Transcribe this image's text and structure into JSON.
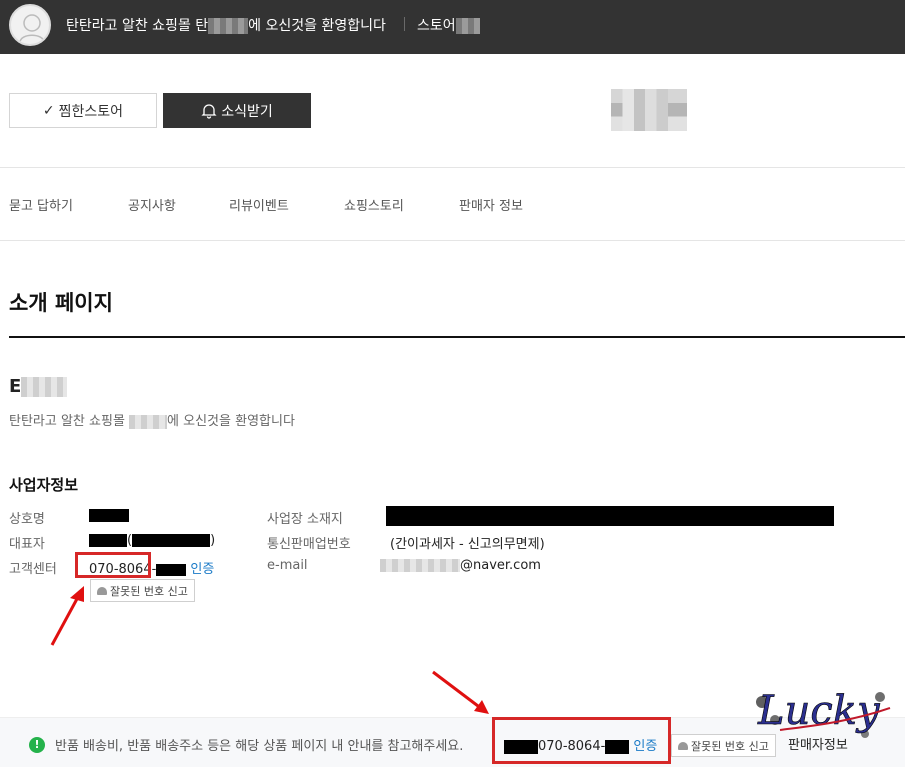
{
  "header": {
    "welcome_prefix": "탄탄라고 알찬 쇼핑몰 탄",
    "welcome_suffix": "에 오신것을 환영합니다",
    "store_link": "스토어"
  },
  "actions": {
    "favorite_label": "찜한스토어",
    "notify_label": "소식받기"
  },
  "nav": {
    "items": [
      "묻고 답하기",
      "공지사항",
      "리뷰이벤트",
      "쇼핑스토리",
      "판매자 정보"
    ]
  },
  "page": {
    "title": "소개 페이지",
    "store_name_initial": "E",
    "store_desc_prefix": "탄탄라고 알찬 쇼핑몰",
    "store_desc_suffix": "에 오신것을 환영합니다"
  },
  "business": {
    "section_title": "사업자정보",
    "labels": {
      "company": "상호명",
      "ceo": "대표자",
      "customer_center": "고객센터",
      "address": "사업장 소재지",
      "mail_order_no": "통신판매업번호",
      "email": "e-mail"
    },
    "ceo_suffix": "(",
    "ceo_close": ")",
    "phone_prefix": "070-8064-",
    "verified": "인증",
    "mail_order_value": "(간이과세자 - 신고의무면제)",
    "email_domain": "@naver.com",
    "report_button": "잘못된 번호 신고"
  },
  "notice": {
    "text": "반품 배송비, 반품 배송주소 등은 해당 상품 페이지 내 안내를 참고해주세요.",
    "phone_prefix": "070-8064-",
    "verified": "인증",
    "report_button": "잘못된 번호 신고",
    "seller_info": "판매자정보"
  },
  "watermark": {
    "text": "Lucky"
  },
  "colors": {
    "topbar": "#333333",
    "highlight": "#d62828",
    "verify_link": "#1a7ac7",
    "notice_icon": "#24b24b"
  }
}
